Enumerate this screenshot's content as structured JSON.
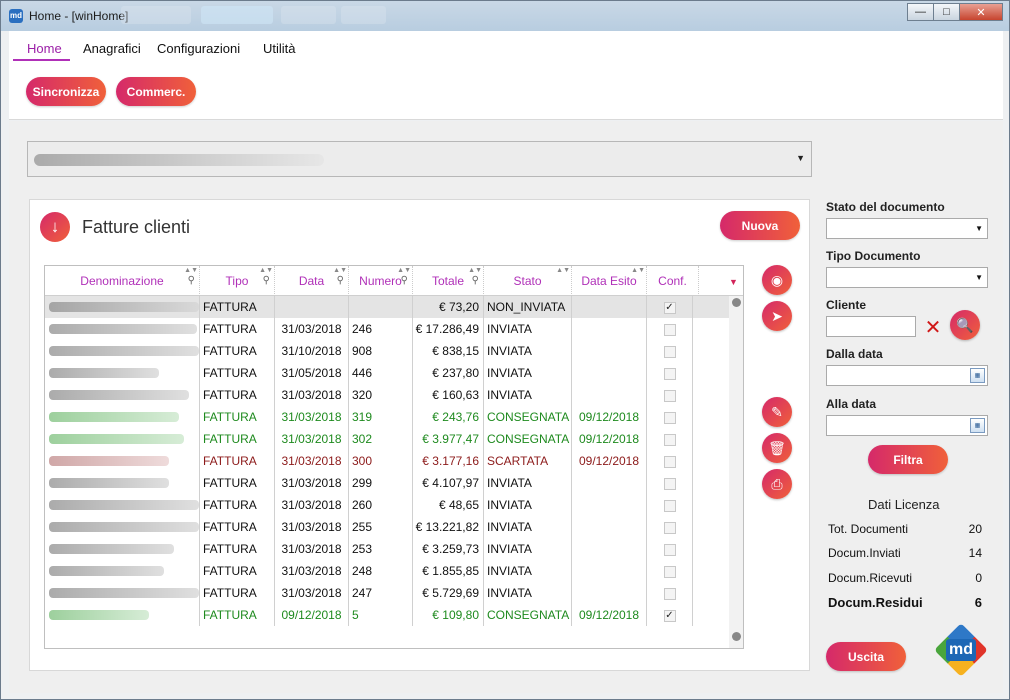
{
  "window": {
    "title": "Home - [winHome]",
    "icon": "md-app-icon"
  },
  "menu": {
    "items": [
      {
        "label": "Home",
        "active": true
      },
      {
        "label": "Anagrafici",
        "active": false
      },
      {
        "label": "Configurazioni",
        "active": false
      },
      {
        "label": "Utilità",
        "active": false
      }
    ]
  },
  "actions": {
    "sync_label": "Sincronizza",
    "commerc_label": "Commerc."
  },
  "company_combo": {
    "value_blurred": true
  },
  "panel": {
    "title": "Fatture clienti",
    "new_label": "Nuova"
  },
  "grid": {
    "columns": [
      "Denominazione",
      "Tipo",
      "Data",
      "Numero",
      "Totale",
      "Stato",
      "Data Esito",
      "Conf."
    ],
    "rows": [
      {
        "tipo": "FATTURA",
        "data": "",
        "numero": "",
        "totale": "€ 73,20",
        "stato": "NON_INVIATA",
        "esito": "",
        "conf": true,
        "style": "sel"
      },
      {
        "tipo": "FATTURA",
        "data": "31/03/2018",
        "numero": "246",
        "totale": "€ 17.286,49",
        "stato": "INVIATA",
        "esito": "",
        "conf": false,
        "style": ""
      },
      {
        "tipo": "FATTURA",
        "data": "31/10/2018",
        "numero": "908",
        "totale": "€ 838,15",
        "stato": "INVIATA",
        "esito": "",
        "conf": false,
        "style": ""
      },
      {
        "tipo": "FATTURA",
        "data": "31/05/2018",
        "numero": "446",
        "totale": "€ 237,80",
        "stato": "INVIATA",
        "esito": "",
        "conf": false,
        "style": ""
      },
      {
        "tipo": "FATTURA",
        "data": "31/03/2018",
        "numero": "320",
        "totale": "€ 160,63",
        "stato": "INVIATA",
        "esito": "",
        "conf": false,
        "style": ""
      },
      {
        "tipo": "FATTURA",
        "data": "31/03/2018",
        "numero": "319",
        "totale": "€ 243,76",
        "stato": "CONSEGNATA",
        "esito": "09/12/2018",
        "conf": false,
        "style": "green"
      },
      {
        "tipo": "FATTURA",
        "data": "31/03/2018",
        "numero": "302",
        "totale": "€ 3.977,47",
        "stato": "CONSEGNATA",
        "esito": "09/12/2018",
        "conf": false,
        "style": "green"
      },
      {
        "tipo": "FATTURA",
        "data": "31/03/2018",
        "numero": "300",
        "totale": "€ 3.177,16",
        "stato": "SCARTATA",
        "esito": "09/12/2018",
        "conf": false,
        "style": "red"
      },
      {
        "tipo": "FATTURA",
        "data": "31/03/2018",
        "numero": "299",
        "totale": "€ 4.107,97",
        "stato": "INVIATA",
        "esito": "",
        "conf": false,
        "style": ""
      },
      {
        "tipo": "FATTURA",
        "data": "31/03/2018",
        "numero": "260",
        "totale": "€ 48,65",
        "stato": "INVIATA",
        "esito": "",
        "conf": false,
        "style": ""
      },
      {
        "tipo": "FATTURA",
        "data": "31/03/2018",
        "numero": "255",
        "totale": "€ 13.221,82",
        "stato": "INVIATA",
        "esito": "",
        "conf": false,
        "style": ""
      },
      {
        "tipo": "FATTURA",
        "data": "31/03/2018",
        "numero": "253",
        "totale": "€ 3.259,73",
        "stato": "INVIATA",
        "esito": "",
        "conf": false,
        "style": ""
      },
      {
        "tipo": "FATTURA",
        "data": "31/03/2018",
        "numero": "248",
        "totale": "€ 1.855,85",
        "stato": "INVIATA",
        "esito": "",
        "conf": false,
        "style": ""
      },
      {
        "tipo": "FATTURA",
        "data": "31/03/2018",
        "numero": "247",
        "totale": "€ 5.729,69",
        "stato": "INVIATA",
        "esito": "",
        "conf": false,
        "style": ""
      },
      {
        "tipo": "FATTURA",
        "data": "09/12/2018",
        "numero": "5",
        "totale": "€ 109,80",
        "stato": "CONSEGNATA",
        "esito": "09/12/2018",
        "conf": true,
        "style": "green"
      }
    ]
  },
  "side_actions": [
    "eye-icon",
    "send-icon",
    "pencil-icon",
    "trash-icon",
    "print-icon"
  ],
  "filters": {
    "stato_label": "Stato del documento",
    "tipo_label": "Tipo Documento",
    "cliente_label": "Cliente",
    "dalla_label": "Dalla data",
    "alla_label": "Alla data",
    "filtra_label": "Filtra"
  },
  "license": {
    "title": "Dati Licenza",
    "rows": [
      {
        "label": "Tot. Documenti",
        "value": "20"
      },
      {
        "label": "Docum.Inviati",
        "value": "14"
      },
      {
        "label": "Docum.Ricevuti",
        "value": "0"
      },
      {
        "label": "Docum.Residui",
        "value": "6"
      }
    ]
  },
  "exit_label": "Uscita",
  "logo_text": "md",
  "colors": {
    "accent": "#b030b8",
    "gradient_start": "#d5296a",
    "gradient_end": "#f0603a",
    "green": "#1e8a1e",
    "red": "#8c1a1a"
  }
}
